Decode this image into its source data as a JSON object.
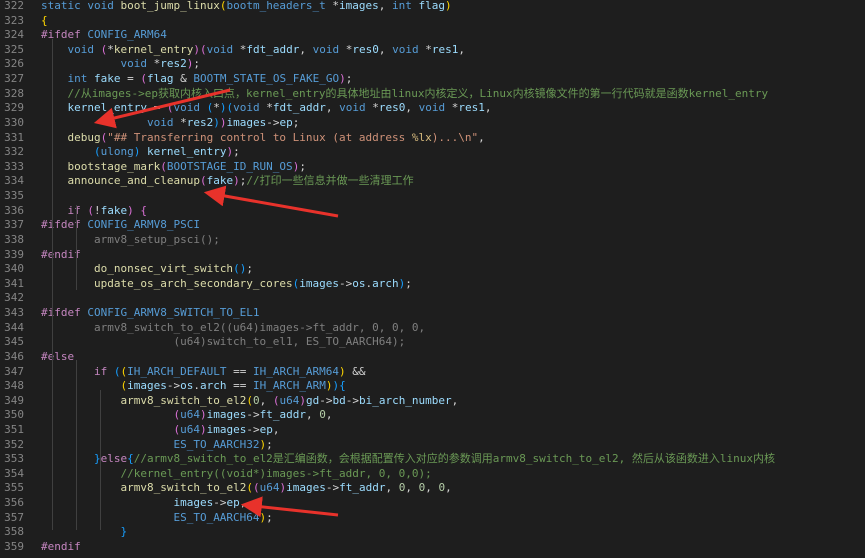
{
  "colors": {
    "background": "#1e1e1e",
    "line_number": "#858585",
    "keyword": "#569cd6",
    "preprocessor": "#c586c0",
    "function": "#dcdcaa",
    "variable": "#9cdcfe",
    "number": "#b5cea8",
    "string": "#ce9178",
    "comment": "#6a9955",
    "annotation_arrow": "#e8322b"
  },
  "lines": [
    {
      "n": "322",
      "tokens": [
        [
          "kw",
          "static "
        ],
        [
          "kw",
          "void "
        ],
        [
          "fn",
          "boot_jump_linux"
        ],
        [
          "br",
          "("
        ],
        [
          "t",
          "bootm_headers_t "
        ],
        [
          "p",
          "*"
        ],
        [
          "var",
          "images"
        ],
        [
          "p",
          ", "
        ],
        [
          "kw",
          "int "
        ],
        [
          "var",
          "flag"
        ],
        [
          "br",
          ")"
        ]
      ]
    },
    {
      "n": "323",
      "tokens": [
        [
          "br",
          "{"
        ]
      ]
    },
    {
      "n": "324",
      "tokens": [
        [
          "pp",
          "#ifdef "
        ],
        [
          "mac",
          "CONFIG_ARM64"
        ]
      ]
    },
    {
      "n": "325",
      "tokens": [
        [
          "p",
          "    "
        ],
        [
          "kw",
          "void "
        ],
        [
          "br2",
          "("
        ],
        [
          "p",
          "*"
        ],
        [
          "fn",
          "kernel_entry"
        ],
        [
          "br2",
          ")"
        ],
        [
          "br2",
          "("
        ],
        [
          "kw",
          "void "
        ],
        [
          "p",
          "*"
        ],
        [
          "var",
          "fdt_addr"
        ],
        [
          "p",
          ", "
        ],
        [
          "kw",
          "void "
        ],
        [
          "p",
          "*"
        ],
        [
          "var",
          "res0"
        ],
        [
          "p",
          ", "
        ],
        [
          "kw",
          "void "
        ],
        [
          "p",
          "*"
        ],
        [
          "var",
          "res1"
        ],
        [
          "p",
          ","
        ]
      ]
    },
    {
      "n": "326",
      "tokens": [
        [
          "p",
          "            "
        ],
        [
          "kw",
          "void "
        ],
        [
          "p",
          "*"
        ],
        [
          "var",
          "res2"
        ],
        [
          "br2",
          ")"
        ],
        [
          "p",
          ";"
        ]
      ]
    },
    {
      "n": "327",
      "tokens": [
        [
          "p",
          "    "
        ],
        [
          "kw",
          "int "
        ],
        [
          "var",
          "fake "
        ],
        [
          "p",
          "= "
        ],
        [
          "br2",
          "("
        ],
        [
          "var",
          "flag "
        ],
        [
          "p",
          "& "
        ],
        [
          "mac",
          "BOOTM_STATE_OS_FAKE_GO"
        ],
        [
          "br2",
          ")"
        ],
        [
          "p",
          ";"
        ]
      ]
    },
    {
      "n": "328",
      "tokens": [
        [
          "p",
          "    "
        ],
        [
          "com",
          "//从images->ep获取内核入口点，kernel_entry的具体地址由linux内核定义，Linux内核镜像文件的第一行代码就是函数kernel_entry"
        ]
      ]
    },
    {
      "n": "329",
      "tokens": [
        [
          "p",
          "    "
        ],
        [
          "var",
          "kernel_entry "
        ],
        [
          "p",
          "= "
        ],
        [
          "br2",
          "("
        ],
        [
          "kw",
          "void "
        ],
        [
          "br3",
          "("
        ],
        [
          "p",
          "*"
        ],
        [
          "br3",
          ")"
        ],
        [
          "br3",
          "("
        ],
        [
          "kw",
          "void "
        ],
        [
          "p",
          "*"
        ],
        [
          "var",
          "fdt_addr"
        ],
        [
          "p",
          ", "
        ],
        [
          "kw",
          "void "
        ],
        [
          "p",
          "*"
        ],
        [
          "var",
          "res0"
        ],
        [
          "p",
          ", "
        ],
        [
          "kw",
          "void "
        ],
        [
          "p",
          "*"
        ],
        [
          "var",
          "res1"
        ],
        [
          "p",
          ","
        ]
      ]
    },
    {
      "n": "330",
      "tokens": [
        [
          "p",
          "                "
        ],
        [
          "kw",
          "void "
        ],
        [
          "p",
          "*"
        ],
        [
          "var",
          "res2"
        ],
        [
          "br3",
          ")"
        ],
        [
          "br2",
          ")"
        ],
        [
          "var",
          "images"
        ],
        [
          "p",
          "->"
        ],
        [
          "var",
          "ep"
        ],
        [
          "p",
          ";"
        ]
      ]
    },
    {
      "n": "331",
      "tokens": [
        [
          "p",
          "    "
        ],
        [
          "fn",
          "debug"
        ],
        [
          "br2",
          "("
        ],
        [
          "str",
          "\"## Transferring control to Linux (at address "
        ],
        [
          "esc",
          "%lx"
        ],
        [
          "str",
          ")...\\n\""
        ],
        [
          "p",
          ","
        ]
      ]
    },
    {
      "n": "332",
      "tokens": [
        [
          "p",
          "        "
        ],
        [
          "br3",
          "("
        ],
        [
          "t",
          "ulong"
        ],
        [
          "br3",
          ") "
        ],
        [
          "var",
          "kernel_entry"
        ],
        [
          "br2",
          ")"
        ],
        [
          "p",
          ";"
        ]
      ]
    },
    {
      "n": "333",
      "tokens": [
        [
          "p",
          "    "
        ],
        [
          "fn",
          "bootstage_mark"
        ],
        [
          "br2",
          "("
        ],
        [
          "mac",
          "BOOTSTAGE_ID_RUN_OS"
        ],
        [
          "br2",
          ")"
        ],
        [
          "p",
          ";"
        ]
      ]
    },
    {
      "n": "334",
      "tokens": [
        [
          "p",
          "    "
        ],
        [
          "fn",
          "announce_and_cleanup"
        ],
        [
          "br2",
          "("
        ],
        [
          "var",
          "fake"
        ],
        [
          "br2",
          ")"
        ],
        [
          "p",
          ";"
        ],
        [
          "com",
          "//打印一些信息并做一些清理工作"
        ]
      ]
    },
    {
      "n": "335",
      "tokens": []
    },
    {
      "n": "336",
      "tokens": [
        [
          "p",
          "    "
        ],
        [
          "pp",
          "if "
        ],
        [
          "br2",
          "("
        ],
        [
          "p",
          "!"
        ],
        [
          "var",
          "fake"
        ],
        [
          "br2",
          ") "
        ],
        [
          "br2",
          "{"
        ]
      ]
    },
    {
      "n": "337",
      "tokens": [
        [
          "pp",
          "#ifdef "
        ],
        [
          "mac",
          "CONFIG_ARMV8_PSCI"
        ]
      ]
    },
    {
      "n": "338",
      "tokens": [
        [
          "p",
          "        "
        ],
        [
          "dis",
          "armv8_setup_psci();"
        ]
      ]
    },
    {
      "n": "339",
      "tokens": [
        [
          "pp",
          "#endif"
        ]
      ]
    },
    {
      "n": "340",
      "tokens": [
        [
          "p",
          "        "
        ],
        [
          "fn",
          "do_nonsec_virt_switch"
        ],
        [
          "br3",
          "("
        ],
        [
          "br3",
          ")"
        ],
        [
          "p",
          ";"
        ]
      ]
    },
    {
      "n": "341",
      "tokens": [
        [
          "p",
          "        "
        ],
        [
          "fn",
          "update_os_arch_secondary_cores"
        ],
        [
          "br3",
          "("
        ],
        [
          "var",
          "images"
        ],
        [
          "p",
          "->"
        ],
        [
          "var",
          "os"
        ],
        [
          "p",
          "."
        ],
        [
          "var",
          "arch"
        ],
        [
          "br3",
          ")"
        ],
        [
          "p",
          ";"
        ]
      ]
    },
    {
      "n": "342",
      "tokens": []
    },
    {
      "n": "343",
      "tokens": [
        [
          "pp",
          "#ifdef "
        ],
        [
          "mac",
          "CONFIG_ARMV8_SWITCH_TO_EL1"
        ]
      ]
    },
    {
      "n": "344",
      "tokens": [
        [
          "p",
          "        "
        ],
        [
          "dis",
          "armv8_switch_to_el2((u64)images->ft_addr, 0, 0, 0,"
        ]
      ]
    },
    {
      "n": "345",
      "tokens": [
        [
          "p",
          "                    "
        ],
        [
          "dis",
          "(u64)switch_to_el1, ES_TO_AARCH64);"
        ]
      ]
    },
    {
      "n": "346",
      "tokens": [
        [
          "pp",
          "#else"
        ]
      ]
    },
    {
      "n": "347",
      "tokens": [
        [
          "p",
          "        "
        ],
        [
          "pp",
          "if "
        ],
        [
          "br3",
          "("
        ],
        [
          "br",
          "("
        ],
        [
          "mac",
          "IH_ARCH_DEFAULT "
        ],
        [
          "p",
          "== "
        ],
        [
          "mac",
          "IH_ARCH_ARM64"
        ],
        [
          "br",
          ") "
        ],
        [
          "p",
          "&&"
        ]
      ]
    },
    {
      "n": "348",
      "tokens": [
        [
          "p",
          "            "
        ],
        [
          "br",
          "("
        ],
        [
          "var",
          "images"
        ],
        [
          "p",
          "->"
        ],
        [
          "var",
          "os"
        ],
        [
          "p",
          "."
        ],
        [
          "var",
          "arch "
        ],
        [
          "p",
          "== "
        ],
        [
          "mac",
          "IH_ARCH_ARM"
        ],
        [
          "br",
          ")"
        ],
        [
          "br3",
          ")"
        ],
        [
          "br3",
          "{"
        ]
      ]
    },
    {
      "n": "349",
      "tokens": [
        [
          "p",
          "            "
        ],
        [
          "fn",
          "armv8_switch_to_el2"
        ],
        [
          "br",
          "("
        ],
        [
          "num",
          "0"
        ],
        [
          "p",
          ", "
        ],
        [
          "br2",
          "("
        ],
        [
          "t",
          "u64"
        ],
        [
          "br2",
          ")"
        ],
        [
          "var",
          "gd"
        ],
        [
          "p",
          "->"
        ],
        [
          "var",
          "bd"
        ],
        [
          "p",
          "->"
        ],
        [
          "var",
          "bi_arch_number"
        ],
        [
          "p",
          ","
        ]
      ]
    },
    {
      "n": "350",
      "tokens": [
        [
          "p",
          "                    "
        ],
        [
          "br2",
          "("
        ],
        [
          "t",
          "u64"
        ],
        [
          "br2",
          ")"
        ],
        [
          "var",
          "images"
        ],
        [
          "p",
          "->"
        ],
        [
          "var",
          "ft_addr"
        ],
        [
          "p",
          ", "
        ],
        [
          "num",
          "0"
        ],
        [
          "p",
          ","
        ]
      ]
    },
    {
      "n": "351",
      "tokens": [
        [
          "p",
          "                    "
        ],
        [
          "br2",
          "("
        ],
        [
          "t",
          "u64"
        ],
        [
          "br2",
          ")"
        ],
        [
          "var",
          "images"
        ],
        [
          "p",
          "->"
        ],
        [
          "var",
          "ep"
        ],
        [
          "p",
          ","
        ]
      ]
    },
    {
      "n": "352",
      "tokens": [
        [
          "p",
          "                    "
        ],
        [
          "mac",
          "ES_TO_AARCH32"
        ],
        [
          "br",
          ")"
        ],
        [
          "p",
          ";"
        ]
      ]
    },
    {
      "n": "353",
      "tokens": [
        [
          "p",
          "        "
        ],
        [
          "br3",
          "}"
        ],
        [
          "pp",
          "else"
        ],
        [
          "br3",
          "{"
        ],
        [
          "com",
          "//armv8_switch_to_el2是汇编函数，会根据配置传入对应的参数调用armv8_switch_to_el2, 然后从该函数进入linux内核"
        ]
      ]
    },
    {
      "n": "354",
      "tokens": [
        [
          "p",
          "            "
        ],
        [
          "com",
          "//kernel_entry((void*)images->ft_addr, 0, 0,0);"
        ]
      ]
    },
    {
      "n": "355",
      "tokens": [
        [
          "p",
          "            "
        ],
        [
          "fn",
          "armv8_switch_to_el2"
        ],
        [
          "br",
          "("
        ],
        [
          "br2",
          "("
        ],
        [
          "t",
          "u64"
        ],
        [
          "br2",
          ")"
        ],
        [
          "var",
          "images"
        ],
        [
          "p",
          "->"
        ],
        [
          "var",
          "ft_addr"
        ],
        [
          "p",
          ", "
        ],
        [
          "num",
          "0"
        ],
        [
          "p",
          ", "
        ],
        [
          "num",
          "0"
        ],
        [
          "p",
          ", "
        ],
        [
          "num",
          "0"
        ],
        [
          "p",
          ","
        ]
      ]
    },
    {
      "n": "356",
      "tokens": [
        [
          "p",
          "                    "
        ],
        [
          "var",
          "images"
        ],
        [
          "p",
          "->"
        ],
        [
          "var",
          "ep"
        ],
        [
          "p",
          ","
        ]
      ]
    },
    {
      "n": "357",
      "tokens": [
        [
          "p",
          "                    "
        ],
        [
          "mac",
          "ES_TO_AARCH64"
        ],
        [
          "br",
          ")"
        ],
        [
          "p",
          ";"
        ]
      ]
    },
    {
      "n": "358",
      "tokens": [
        [
          "p",
          "            "
        ],
        [
          "br3",
          "}"
        ]
      ]
    },
    {
      "n": "359",
      "tokens": [
        [
          "pp",
          "#endif"
        ]
      ]
    }
  ]
}
